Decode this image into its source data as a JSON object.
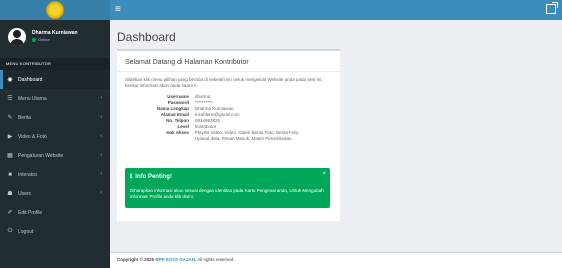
{
  "header": {
    "logo_icon": "seal-icon",
    "toggle_icon": "hamburger-icon",
    "exit_icon": "external-link-icon",
    "accent": "#3c8dbc"
  },
  "sidebar": {
    "user": {
      "name": "Dharma Kurniawan",
      "status": "Online"
    },
    "menu_header": "MENU KONTRIBUTOR",
    "items": [
      {
        "label": "Dashboard",
        "icon": "dashboard-icon"
      },
      {
        "label": "Menu Utama",
        "icon": "menu-icon"
      },
      {
        "label": "Berita",
        "icon": "pencil-icon"
      },
      {
        "label": "Video & Foto",
        "icon": "play-icon"
      },
      {
        "label": "Pengaturan Website",
        "icon": "chart-icon"
      },
      {
        "label": "Interaksi",
        "icon": "comment-icon"
      },
      {
        "label": "Users",
        "icon": "users-icon"
      },
      {
        "label": "Edit Profile",
        "icon": "edit-icon"
      },
      {
        "label": "Logout",
        "icon": "power-icon"
      }
    ]
  },
  "main": {
    "title": "Dashboard",
    "box": {
      "title": "Selamat Datang di Halaman Kontributor",
      "intro": "Silahkan klik menu pilihan yang berada di sebelah kiri untuk mengelola Website anda pada web ini, berikut informasi akun anda saat ini :",
      "fields": [
        {
          "label": "Username",
          "value": "dharma"
        },
        {
          "label": "Password",
          "value": "**********"
        },
        {
          "label": "Nama Lengkap",
          "value": "Dharma Kurniawan"
        },
        {
          "label": "Alamat Email",
          "value": "k.koblerm@gmail.com"
        },
        {
          "label": "No. Telpon",
          "value": "0814983825"
        },
        {
          "label": "Level",
          "value": "kontributor"
        },
        {
          "label": "Hak Akses",
          "value": "Playlist Video, Video, Galeri Berita Foto, Berita Foto, Upload data, Pesan Masuk, Materi Pemeriksaan,"
        }
      ]
    },
    "alert": {
      "title": "Info Penting!",
      "text": "Diharapkan informasi akun sesuai dengan identitas pada Kartu Pengenal anda, Untuk Mengubah informasi Profile anda klik disini.",
      "color": "#00a65a"
    }
  },
  "footer": {
    "prefix": "Copyright © 2025",
    "link": "BPP KOTA GAJAH.",
    "suffix": "All rights reserved."
  }
}
